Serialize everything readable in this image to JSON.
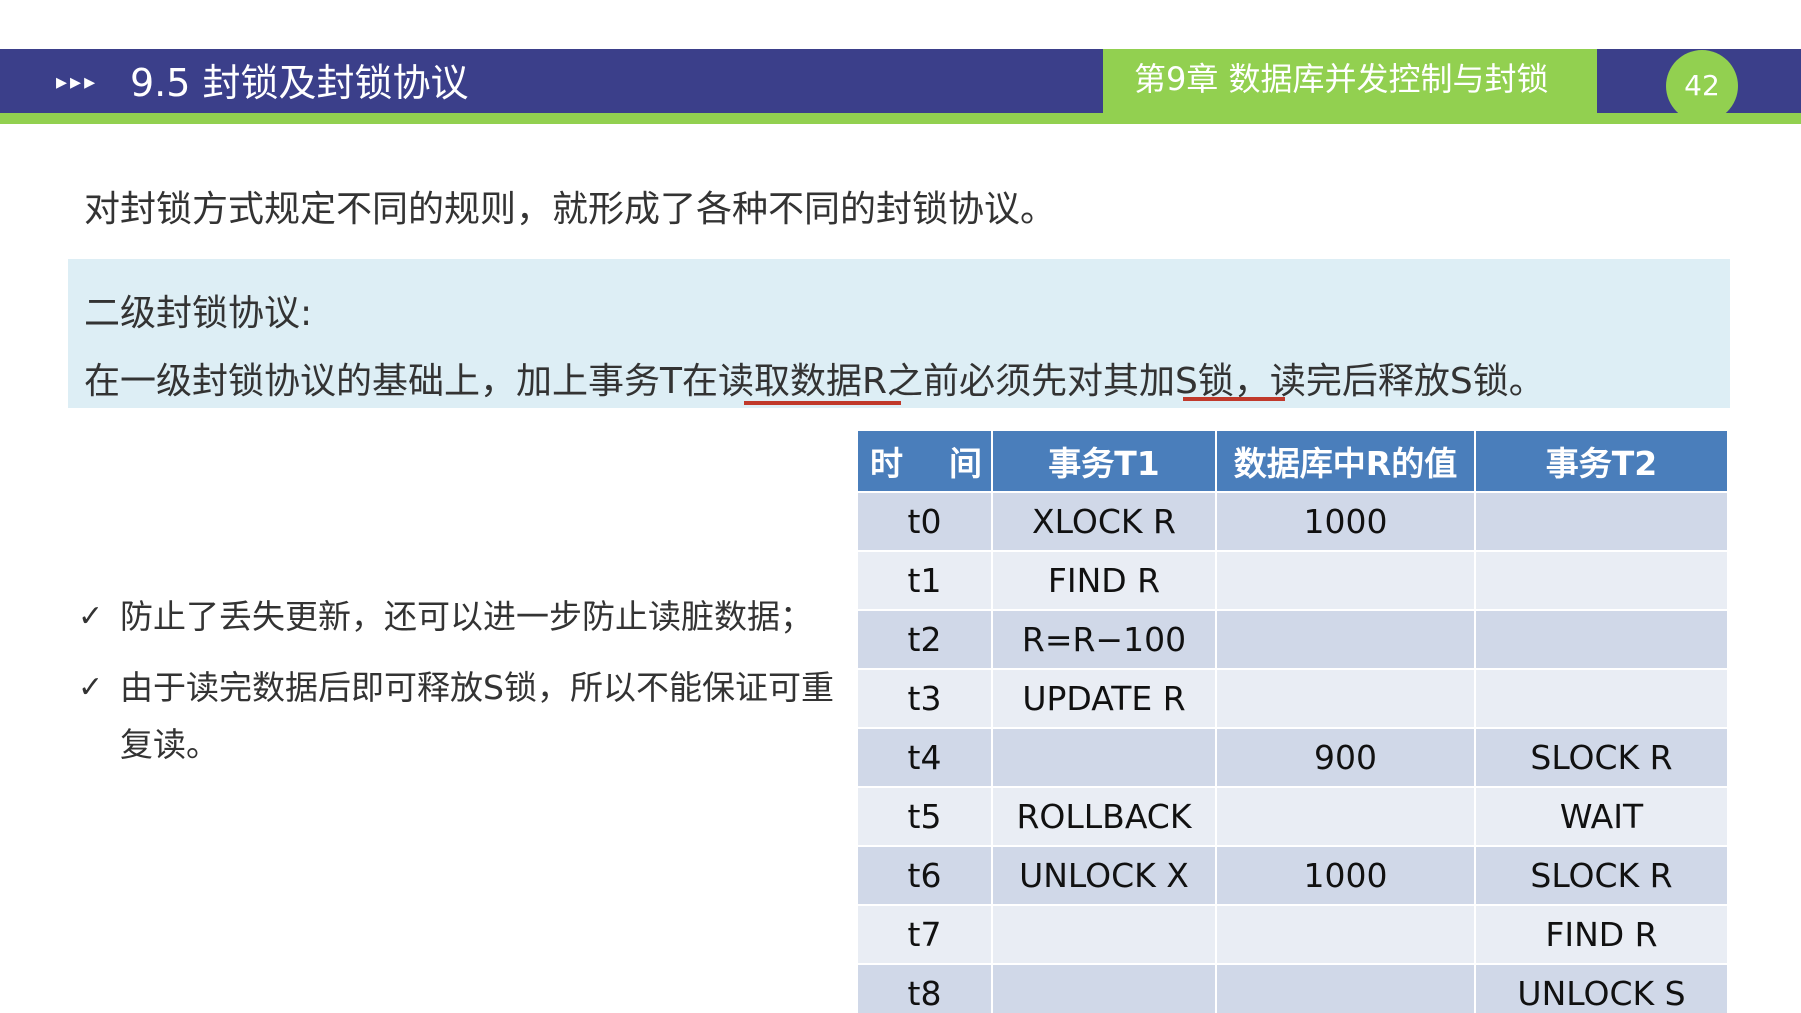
{
  "header": {
    "arrows": "▸▸▸",
    "section_title": "9.5  封锁及封锁协议",
    "chapter_title": "第9章 数据库并发控制与封锁",
    "page_number": "42"
  },
  "intro": "对封锁方式规定不同的规则，就形成了各种不同的封锁协议。",
  "protocol": {
    "title": "二级封锁协议:",
    "desc_parts": [
      "在一级封锁协议的基础上，加上事务T在",
      "读取数据R",
      "之前必须先对其",
      "加S锁",
      "，读完后释放S锁。"
    ]
  },
  "bullets": [
    "防止了丢失更新，还可以进一步防止读脏数据；",
    "由于读完数据后即可释放S锁，所以不能保证可重复读。"
  ],
  "check_glyph": "✓",
  "table": {
    "headers": [
      "时    间",
      "事务T1",
      "数据库中R的值",
      "事务T2"
    ],
    "rows": [
      [
        "t0",
        "XLOCK R",
        "1000",
        ""
      ],
      [
        "t1",
        "FIND R",
        "",
        ""
      ],
      [
        "t2",
        "R=R−100",
        "",
        ""
      ],
      [
        "t3",
        "UPDATE R",
        "",
        ""
      ],
      [
        "t4",
        "",
        "900",
        "SLOCK R"
      ],
      [
        "t5",
        "ROLLBACK",
        "",
        "WAIT"
      ],
      [
        "t6",
        "UNLOCK X",
        "1000",
        "SLOCK R"
      ],
      [
        "t7",
        "",
        "",
        "FIND R"
      ],
      [
        "t8",
        "",
        "",
        "UNLOCK S"
      ]
    ]
  },
  "colors": {
    "header_bar": "#3b3f8a",
    "accent_green": "#92d050",
    "table_header": "#4a7ebb",
    "row_dark": "#d0d8e8",
    "row_light": "#e9edf4",
    "highlight_box": "#ddeef5",
    "underline": "#c0392b"
  }
}
